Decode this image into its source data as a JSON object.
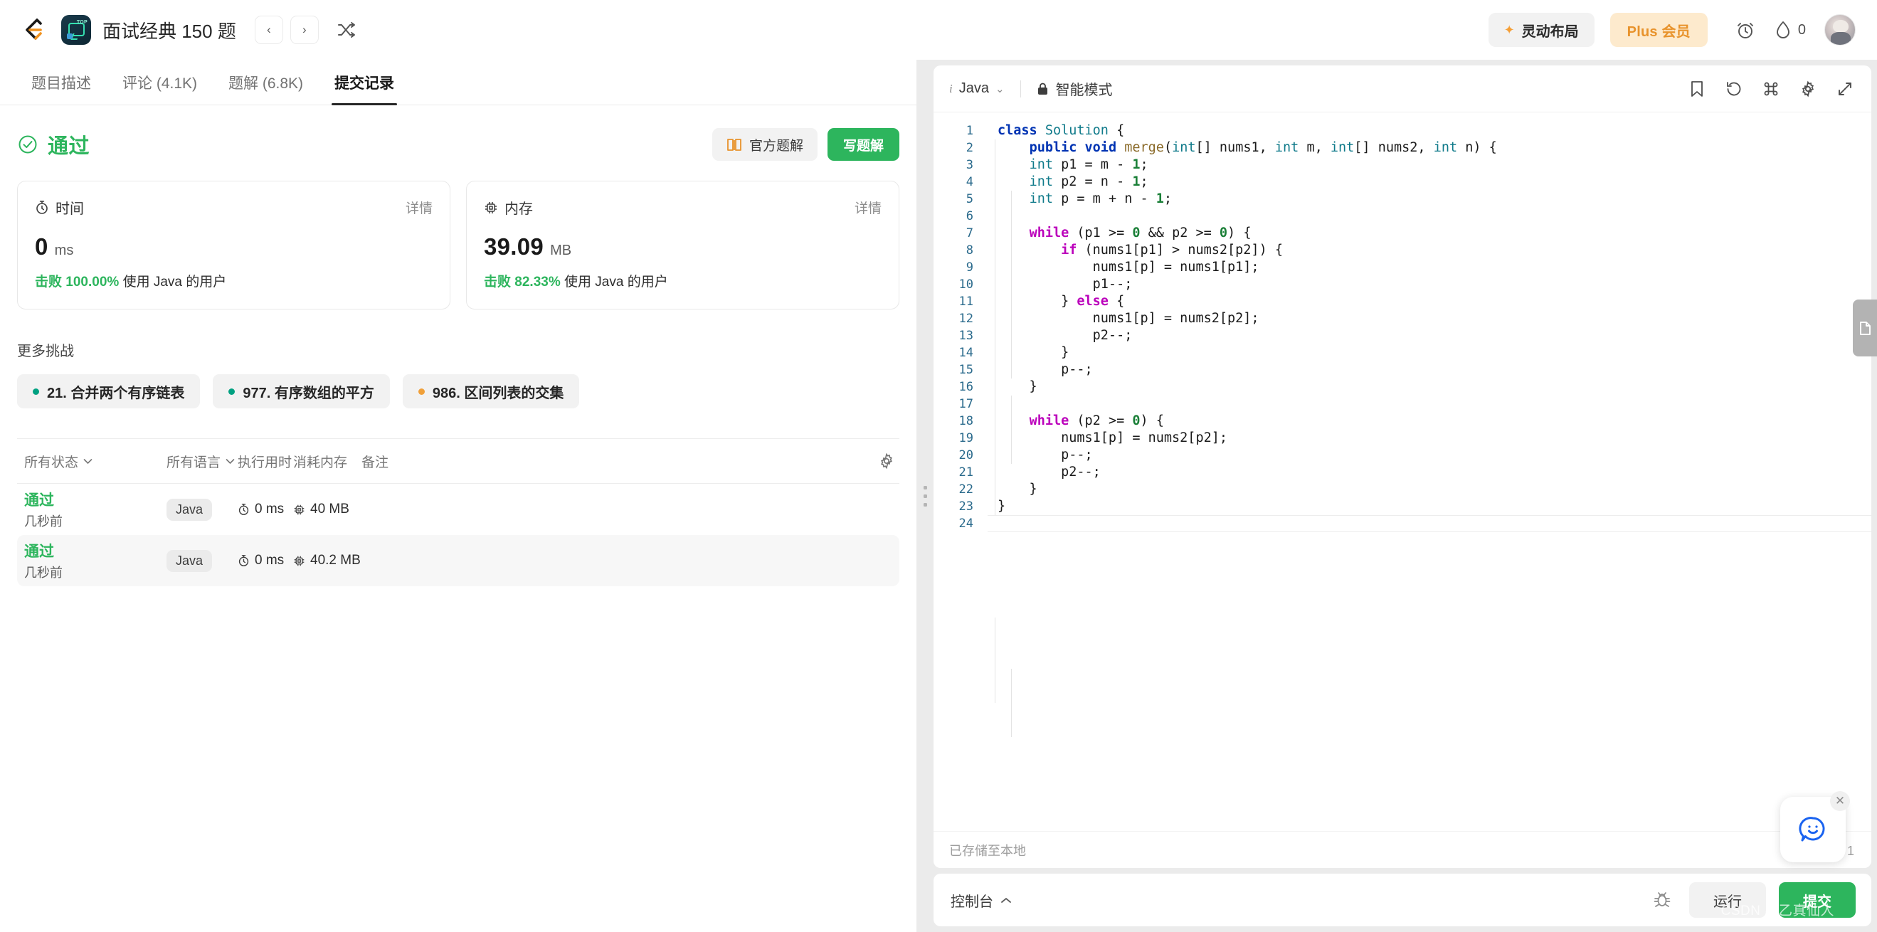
{
  "header": {
    "problem_title": "面试经典 150 题",
    "prev_label": "‹",
    "next_label": "›",
    "shuffle_icon": "shuffle-icon",
    "dynamic_layout_label": "灵动布局",
    "plus_label": "Plus 会员",
    "timer_icon": "alarm-clock-icon",
    "streak_count": "0",
    "avatar_name": "user-avatar",
    "accent_green": "#2db55d",
    "accent_orange": "#e8932c"
  },
  "tabs": [
    {
      "label": "题目描述",
      "active": false
    },
    {
      "label": "评论 (4.1K)",
      "active": false
    },
    {
      "label": "题解 (6.8K)",
      "active": false
    },
    {
      "label": "提交记录",
      "active": true
    }
  ],
  "result": {
    "status": "通过",
    "official_solution_label": "官方题解",
    "write_solution_label": "写题解",
    "cards": [
      {
        "title": "时间",
        "icon": "stopwatch-icon",
        "detail_label": "详情",
        "value": "0",
        "unit": "ms",
        "beat_prefix": "击败 100.00%",
        "beat_suffix": "使用 Java 的用户"
      },
      {
        "title": "内存",
        "icon": "memory-chip-icon",
        "detail_label": "详情",
        "value": "39.09",
        "unit": "MB",
        "beat_prefix": "击败 82.33%",
        "beat_suffix": "使用 Java 的用户"
      }
    ],
    "more_challenges_title": "更多挑战",
    "challenges": [
      {
        "label": "21. 合并两个有序链表",
        "dot_color": "#00a181"
      },
      {
        "label": "977. 有序数组的平方",
        "dot_color": "#00a181"
      },
      {
        "label": "986. 区间列表的交集",
        "dot_color": "#f0a03a"
      }
    ]
  },
  "submissions": {
    "filters": {
      "status_filter": "所有状态",
      "language_filter": "所有语言"
    },
    "columns": [
      "所有状态",
      "所有语言",
      "执行用时",
      "消耗内存",
      "备注"
    ],
    "settings_icon": "gear-icon",
    "rows": [
      {
        "status": "通过",
        "time_ago": "几秒前",
        "language": "Java",
        "runtime": "0 ms",
        "memory": "40 MB",
        "note": ""
      },
      {
        "status": "通过",
        "time_ago": "几秒前",
        "language": "Java",
        "runtime": "0 ms",
        "memory": "40.2 MB",
        "note": ""
      }
    ]
  },
  "editor": {
    "language": "Java",
    "info_icon": "info-icon",
    "chevron": "⌄",
    "lock_icon": "lock-icon",
    "smart_mode": "智能模式",
    "icons": [
      "bookmark-icon",
      "reset-icon",
      "command-icon",
      "gear-icon",
      "expand-icon"
    ],
    "status_left": "已存储至本地",
    "status_right": "行 24, 列 1",
    "cursor_line": 24,
    "cursor_col": 1,
    "total_lines": 24,
    "lines": [
      {
        "n": 1,
        "tokens": [
          [
            "kw",
            "class"
          ],
          [
            "plain",
            " "
          ],
          [
            "typ",
            "Solution"
          ],
          [
            "plain",
            " {"
          ]
        ]
      },
      {
        "n": 2,
        "tokens": [
          [
            "plain",
            "    "
          ],
          [
            "kw",
            "public"
          ],
          [
            "plain",
            " "
          ],
          [
            "kw",
            "void"
          ],
          [
            "plain",
            " "
          ],
          [
            "fn",
            "merge"
          ],
          [
            "plain",
            "("
          ],
          [
            "typ",
            "int"
          ],
          [
            "plain",
            "[] nums1, "
          ],
          [
            "typ",
            "int"
          ],
          [
            "plain",
            " m, "
          ],
          [
            "typ",
            "int"
          ],
          [
            "plain",
            "[] nums2, "
          ],
          [
            "typ",
            "int"
          ],
          [
            "plain",
            " n) {"
          ]
        ]
      },
      {
        "n": 3,
        "tokens": [
          [
            "plain",
            "    "
          ],
          [
            "typ",
            "int"
          ],
          [
            "plain",
            " p1 = m - "
          ],
          [
            "num2",
            "1"
          ],
          [
            "plain",
            ";"
          ]
        ]
      },
      {
        "n": 4,
        "tokens": [
          [
            "plain",
            "    "
          ],
          [
            "typ",
            "int"
          ],
          [
            "plain",
            " p2 = n - "
          ],
          [
            "num2",
            "1"
          ],
          [
            "plain",
            ";"
          ]
        ]
      },
      {
        "n": 5,
        "tokens": [
          [
            "plain",
            "    "
          ],
          [
            "typ",
            "int"
          ],
          [
            "plain",
            " p = m + n - "
          ],
          [
            "num2",
            "1"
          ],
          [
            "plain",
            ";"
          ]
        ]
      },
      {
        "n": 6,
        "tokens": [
          [
            "plain",
            ""
          ]
        ]
      },
      {
        "n": 7,
        "tokens": [
          [
            "plain",
            "    "
          ],
          [
            "ctl",
            "while"
          ],
          [
            "plain",
            " (p1 >= "
          ],
          [
            "num2",
            "0"
          ],
          [
            "plain",
            " && p2 >= "
          ],
          [
            "num2",
            "0"
          ],
          [
            "plain",
            ") {"
          ]
        ]
      },
      {
        "n": 8,
        "tokens": [
          [
            "plain",
            "        "
          ],
          [
            "ctl",
            "if"
          ],
          [
            "plain",
            " (nums1[p1] > nums2[p2]) {"
          ]
        ]
      },
      {
        "n": 9,
        "tokens": [
          [
            "plain",
            "            nums1[p] = nums1[p1];"
          ]
        ]
      },
      {
        "n": 10,
        "tokens": [
          [
            "plain",
            "            p1--;"
          ]
        ]
      },
      {
        "n": 11,
        "tokens": [
          [
            "plain",
            "        } "
          ],
          [
            "ctl",
            "else"
          ],
          [
            "plain",
            " {"
          ]
        ]
      },
      {
        "n": 12,
        "tokens": [
          [
            "plain",
            "            nums1[p] = nums2[p2];"
          ]
        ]
      },
      {
        "n": 13,
        "tokens": [
          [
            "plain",
            "            p2--;"
          ]
        ]
      },
      {
        "n": 14,
        "tokens": [
          [
            "plain",
            "        }"
          ]
        ]
      },
      {
        "n": 15,
        "tokens": [
          [
            "plain",
            "        p--;"
          ]
        ]
      },
      {
        "n": 16,
        "tokens": [
          [
            "plain",
            "    }"
          ]
        ]
      },
      {
        "n": 17,
        "tokens": [
          [
            "plain",
            ""
          ]
        ]
      },
      {
        "n": 18,
        "tokens": [
          [
            "plain",
            "    "
          ],
          [
            "ctl",
            "while"
          ],
          [
            "plain",
            " (p2 >= "
          ],
          [
            "num2",
            "0"
          ],
          [
            "plain",
            ") {"
          ]
        ]
      },
      {
        "n": 19,
        "tokens": [
          [
            "plain",
            "        nums1[p] = nums2[p2];"
          ]
        ]
      },
      {
        "n": 20,
        "tokens": [
          [
            "plain",
            "        p--;"
          ]
        ]
      },
      {
        "n": 21,
        "tokens": [
          [
            "plain",
            "        p2--;"
          ]
        ]
      },
      {
        "n": 22,
        "tokens": [
          [
            "plain",
            "    }"
          ]
        ]
      },
      {
        "n": 23,
        "tokens": [
          [
            "plain",
            "}"
          ]
        ]
      },
      {
        "n": 24,
        "tokens": [
          [
            "plain",
            ""
          ]
        ]
      }
    ]
  },
  "console": {
    "label": "控制台",
    "chevron": "⌃",
    "debug_icon": "bug-icon",
    "run_label": "运行",
    "submit_label": "提交"
  },
  "floating": {
    "doc_tab_icon": "document-icon",
    "chat_icon": "chat-smiley-icon",
    "close_icon": "✕"
  },
  "watermark": "CSDN @乙真仙人"
}
